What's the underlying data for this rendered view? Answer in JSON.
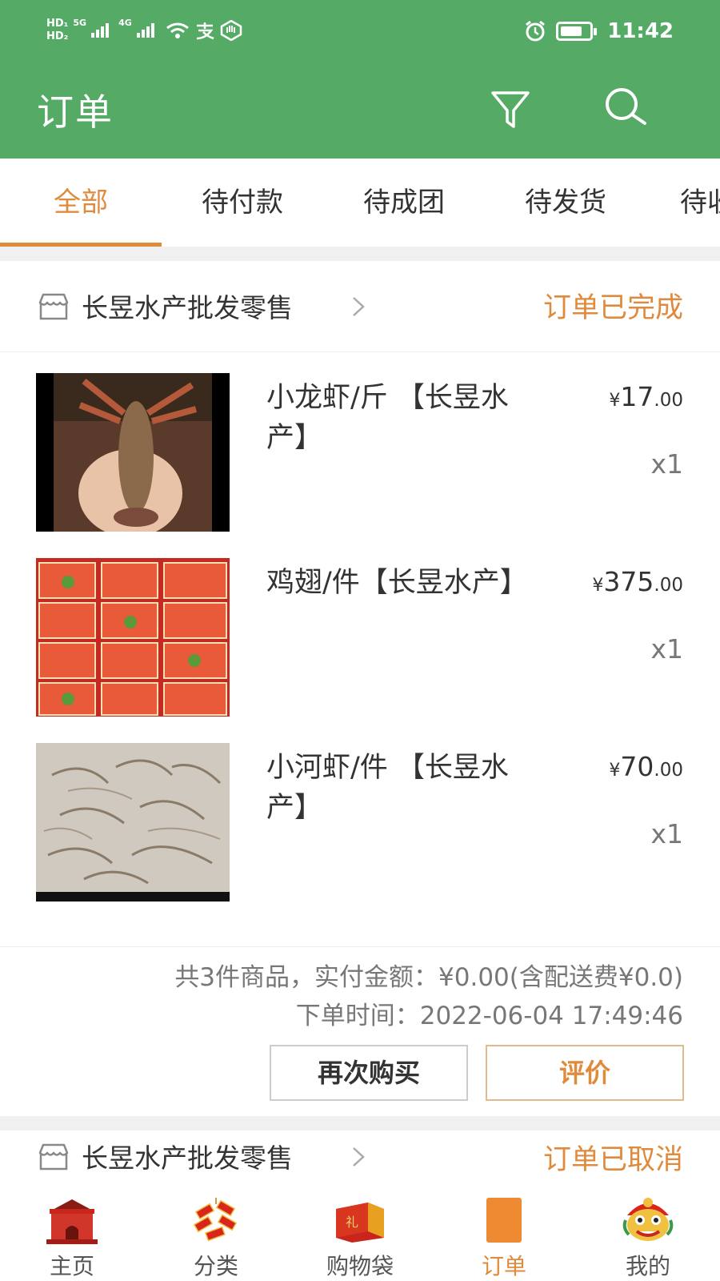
{
  "status_bar": {
    "hd1": "HD₁",
    "hd2": "HD₂",
    "net1": "5G",
    "net2": "4G",
    "time": "11:42"
  },
  "header": {
    "title": "订单",
    "filter_icon": "filter-icon",
    "search_icon": "search-icon"
  },
  "tabs": [
    "全部",
    "待付款",
    "待成团",
    "待发货",
    "待收货"
  ],
  "orders": [
    {
      "shop": "长昱水产批发零售",
      "status": "订单已完成",
      "items": [
        {
          "name": "小龙虾/斤 【长昱水产】",
          "price_int": "17",
          "price_dec": ".00",
          "qty": "x1"
        },
        {
          "name": "鸡翅/件【长昱水产】",
          "price_int": "375",
          "price_dec": ".00",
          "qty": "x1"
        },
        {
          "name": "小河虾/件 【长昱水产】",
          "price_int": "70",
          "price_dec": ".00",
          "qty": "x1"
        }
      ],
      "summary": "共3件商品，实付金额：¥0.00(含配送费¥0.0)",
      "order_time": "下单时间：2022-06-04 17:49:46",
      "buy_again": "再次购买",
      "rate": "评价"
    },
    {
      "shop": "长昱水产批发零售",
      "status": "订单已取消"
    }
  ],
  "currency": "¥",
  "bottom_nav": [
    {
      "label": "主页",
      "icon": "home-gate-icon"
    },
    {
      "label": "分类",
      "icon": "firecracker-icon"
    },
    {
      "label": "购物袋",
      "icon": "gift-bag-icon"
    },
    {
      "label": "订单",
      "icon": "order-icon"
    },
    {
      "label": "我的",
      "icon": "lion-dance-icon"
    }
  ],
  "colors": {
    "primary_green": "#55ab66",
    "accent_orange": "#e08a3c"
  }
}
